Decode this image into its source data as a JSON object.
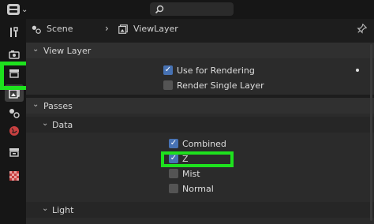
{
  "topbar": {
    "editor_icon": "properties-editor-icon",
    "search_placeholder": ""
  },
  "header": {
    "scene": "Scene",
    "view_layer": "ViewLayer"
  },
  "sidebar": {
    "tabs": [
      {
        "icon": "tool-icon"
      },
      {
        "icon": "render-icon"
      },
      {
        "icon": "output-icon"
      },
      {
        "icon": "view-layer-icon"
      },
      {
        "icon": "scene-icon"
      },
      {
        "icon": "world-icon"
      },
      {
        "icon": "collection-icon"
      },
      {
        "icon": "texture-icon"
      }
    ]
  },
  "view_layer": {
    "title": "View Layer",
    "use_for_rendering": {
      "label": "Use for Rendering",
      "checked": true
    },
    "render_single_layer": {
      "label": "Render Single Layer",
      "checked": false
    }
  },
  "passes": {
    "title": "Passes",
    "data": {
      "title": "Data",
      "items": [
        {
          "label": "Combined",
          "checked": true
        },
        {
          "label": "Z",
          "checked": true
        },
        {
          "label": "Mist",
          "checked": false
        },
        {
          "label": "Normal",
          "checked": false
        }
      ]
    },
    "light": {
      "title": "Light"
    }
  },
  "colors": {
    "accent": "#4772b3",
    "highlight": "#1ee11e"
  }
}
